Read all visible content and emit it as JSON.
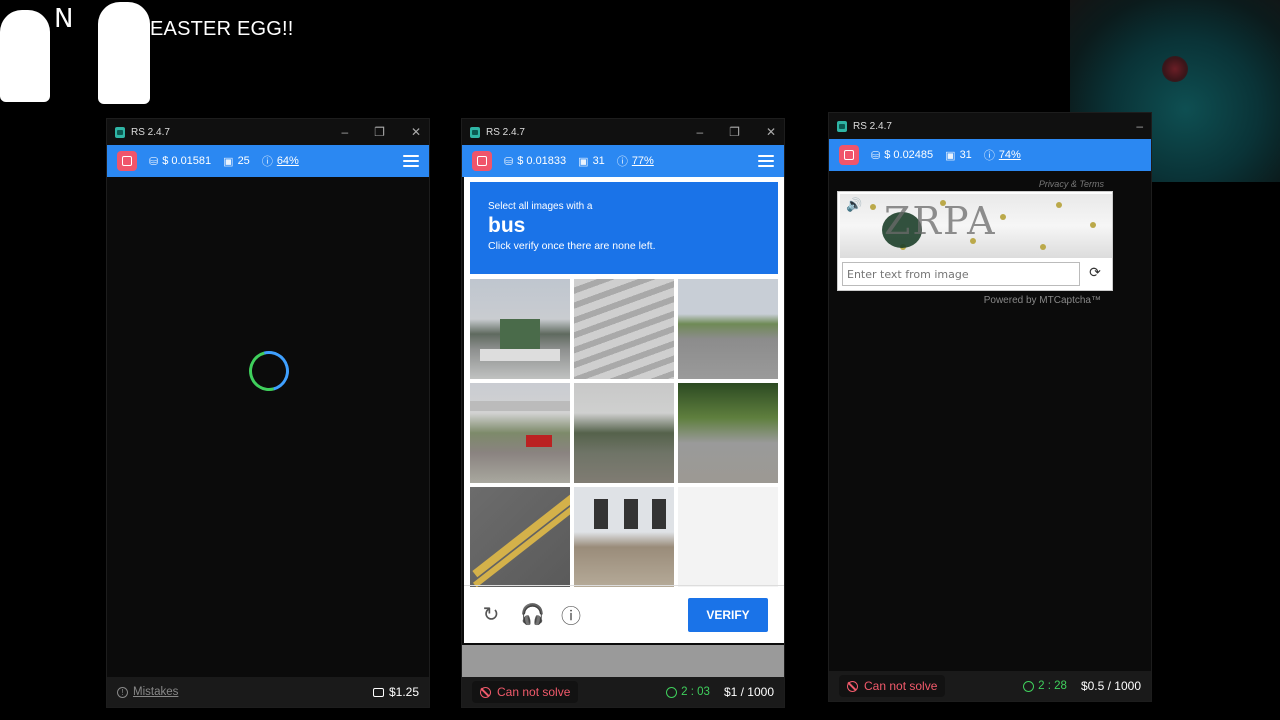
{
  "overlay": {
    "meme_letter": "N",
    "caption": "EASTER EGG!!"
  },
  "windows": [
    {
      "title": "RS 2.4.7",
      "balance": "$ 0.01581",
      "solved": "25",
      "accuracy": "64%",
      "footer_left": "Mistakes",
      "footer_right": "$1.25"
    },
    {
      "title": "RS 2.4.7",
      "balance": "$ 0.01833",
      "solved": "31",
      "accuracy": "77%",
      "footer_status": "Can not solve",
      "timer": "2 : 03",
      "rate": "$1 / 1000",
      "captcha": {
        "line1": "Select all images with a",
        "target": "bus",
        "line3": "Click verify once there are none left.",
        "verify_label": "VERIFY"
      }
    },
    {
      "title": "RS 2.4.7",
      "balance": "$ 0.02485",
      "solved": "31",
      "accuracy": "74%",
      "footer_status": "Can not solve",
      "timer": "2 : 28",
      "rate": "$0.5 / 1000",
      "mtcaptcha": {
        "privacy": "Privacy & Terms",
        "image_text": "ZRPA",
        "placeholder": "Enter text from image",
        "powered": "Powered by MTCaptcha™"
      }
    }
  ],
  "colors": {
    "accent_blue": "#2b88f2",
    "stop_red": "#f0556b",
    "ok_green": "#3fcf5c",
    "captcha_blue": "#1a73e8"
  }
}
